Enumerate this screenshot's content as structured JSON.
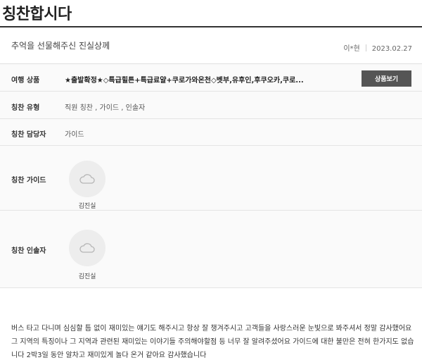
{
  "page": {
    "title": "칭찬합시다"
  },
  "post": {
    "subject": "추억을 선물해주신 진실상께",
    "author": "이*현",
    "date": "2023.02.27",
    "content": "버스 타고 다니며 심심할 틈 없이 재미있는 얘기도 해주시고 항상 잘 챙겨주시고 고객들을 사랑스러운 눈빛으로 봐주셔서 정말 감사했어요 그 지역의 특징이나 그 지역과 관련된 재미있는 이야기들 주의해야할점 등 너무 잘 알려주셨어요 가이드에 대한 불만은 전혀 한가지도 없습니다 2박3일 동안 알차고 재미있게 놀다 온거 같아요 감사했습니다"
  },
  "info": {
    "product_label": "여행 상품",
    "product_value": "★출발확정★◇특급힐튼+특급료얄+쿠로가와온천◇벳부,유후인,후쿠오카,쿠로...",
    "product_button": "상품보기",
    "type_label": "칭찬 유형",
    "type_value": "직원 칭찬 , 가이드 , 인솔자",
    "manager_label": "칭찬 담당자",
    "manager_value": "가이드",
    "guide_label": "칭찬 가이드",
    "guide_name": "김진실",
    "leader_label": "칭찬 인솔자",
    "leader_name": "김진실"
  },
  "icons": {
    "avatar_placeholder": "cloud-icon"
  },
  "colors": {
    "button_bg": "#555555",
    "title_rule": "#333333",
    "table_bg": "#fafafa"
  }
}
